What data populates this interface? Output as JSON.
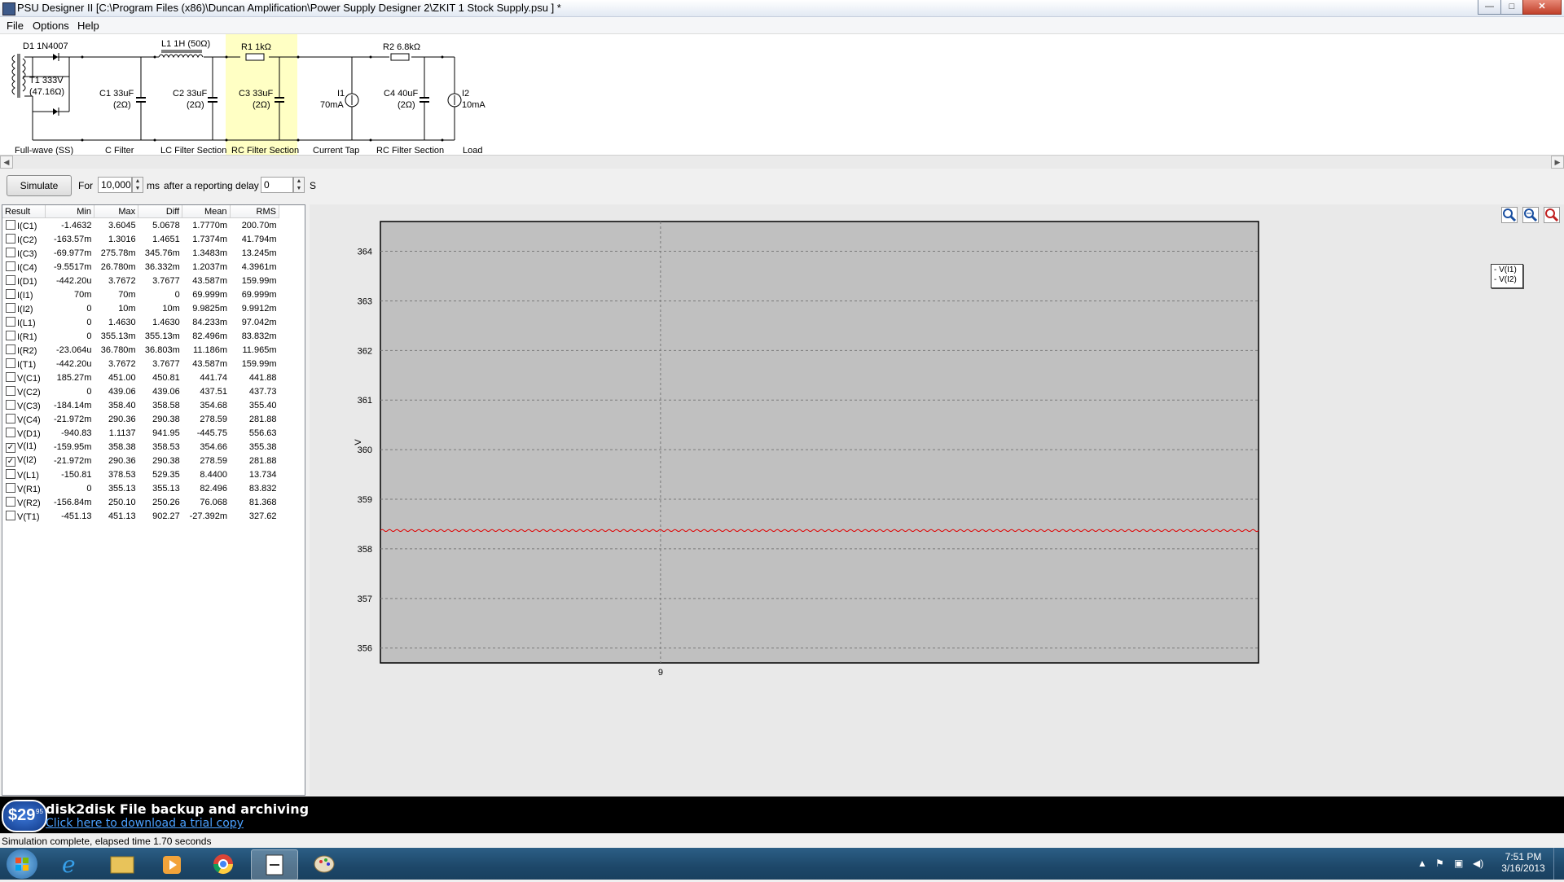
{
  "window": {
    "title": "PSU Designer II  [C:\\Program Files (x86)\\Duncan Amplification\\Power Supply Designer 2\\ZKIT 1 Stock Supply.psu ] *",
    "minimize": "—",
    "maximize": "□",
    "close": "✕"
  },
  "menu": [
    "File",
    "Options",
    "Help"
  ],
  "schematic": {
    "components": {
      "d1": "D1 1N4007",
      "t1": "T1 333V",
      "t1_res": "(47.16Ω)",
      "c1": "C1 33uF",
      "c1_res": "(2Ω)",
      "l1": "L1 1H (50Ω)",
      "c2": "C2 33uF",
      "c2_res": "(2Ω)",
      "r1": "R1 1kΩ",
      "c3": "C3 33uF",
      "c3_res": "(2Ω)",
      "i1": "I1",
      "i1_val": "70mA",
      "r2": "R2 6.8kΩ",
      "c4": "C4 40uF",
      "c4_res": "(2Ω)",
      "i2": "I2",
      "i2_val": "10mA"
    },
    "sections": [
      "Full-wave (SS)",
      "C Filter",
      "LC Filter Section",
      "RC Filter Section",
      "Current Tap",
      "RC Filter Section",
      "Load"
    ]
  },
  "controls": {
    "simulate_label": "Simulate",
    "for_label": "For",
    "duration_value": "10,000",
    "ms_label": "ms",
    "delay_label": "after a reporting delay of",
    "delay_value": "0",
    "s_label": "S"
  },
  "results": {
    "columns": [
      "Result",
      "Min",
      "Max",
      "Diff",
      "Mean",
      "RMS"
    ],
    "rows": [
      {
        "name": "I(C1)",
        "checked": false,
        "min": "-1.4632",
        "max": "3.6045",
        "diff": "5.0678",
        "mean": "1.7770m",
        "rms": "200.70m"
      },
      {
        "name": "I(C2)",
        "checked": false,
        "min": "-163.57m",
        "max": "1.3016",
        "diff": "1.4651",
        "mean": "1.7374m",
        "rms": "41.794m"
      },
      {
        "name": "I(C3)",
        "checked": false,
        "min": "-69.977m",
        "max": "275.78m",
        "diff": "345.76m",
        "mean": "1.3483m",
        "rms": "13.245m"
      },
      {
        "name": "I(C4)",
        "checked": false,
        "min": "-9.5517m",
        "max": "26.780m",
        "diff": "36.332m",
        "mean": "1.2037m",
        "rms": "4.3961m"
      },
      {
        "name": "I(D1)",
        "checked": false,
        "min": "-442.20u",
        "max": "3.7672",
        "diff": "3.7677",
        "mean": "43.587m",
        "rms": "159.99m"
      },
      {
        "name": "I(I1)",
        "checked": false,
        "min": "70m",
        "max": "70m",
        "diff": "0",
        "mean": "69.999m",
        "rms": "69.999m"
      },
      {
        "name": "I(I2)",
        "checked": false,
        "min": "0",
        "max": "10m",
        "diff": "10m",
        "mean": "9.9825m",
        "rms": "9.9912m"
      },
      {
        "name": "I(L1)",
        "checked": false,
        "min": "0",
        "max": "1.4630",
        "diff": "1.4630",
        "mean": "84.233m",
        "rms": "97.042m"
      },
      {
        "name": "I(R1)",
        "checked": false,
        "min": "0",
        "max": "355.13m",
        "diff": "355.13m",
        "mean": "82.496m",
        "rms": "83.832m"
      },
      {
        "name": "I(R2)",
        "checked": false,
        "min": "-23.064u",
        "max": "36.780m",
        "diff": "36.803m",
        "mean": "11.186m",
        "rms": "11.965m"
      },
      {
        "name": "I(T1)",
        "checked": false,
        "min": "-442.20u",
        "max": "3.7672",
        "diff": "3.7677",
        "mean": "43.587m",
        "rms": "159.99m"
      },
      {
        "name": "V(C1)",
        "checked": false,
        "min": "185.27m",
        "max": "451.00",
        "diff": "450.81",
        "mean": "441.74",
        "rms": "441.88"
      },
      {
        "name": "V(C2)",
        "checked": false,
        "min": "0",
        "max": "439.06",
        "diff": "439.06",
        "mean": "437.51",
        "rms": "437.73"
      },
      {
        "name": "V(C3)",
        "checked": false,
        "min": "-184.14m",
        "max": "358.40",
        "diff": "358.58",
        "mean": "354.68",
        "rms": "355.40"
      },
      {
        "name": "V(C4)",
        "checked": false,
        "min": "-21.972m",
        "max": "290.36",
        "diff": "290.38",
        "mean": "278.59",
        "rms": "281.88"
      },
      {
        "name": "V(D1)",
        "checked": false,
        "min": "-940.83",
        "max": "1.1137",
        "diff": "941.95",
        "mean": "-445.75",
        "rms": "556.63"
      },
      {
        "name": "V(I1)",
        "checked": true,
        "min": "-159.95m",
        "max": "358.38",
        "diff": "358.53",
        "mean": "354.66",
        "rms": "355.38"
      },
      {
        "name": "V(I2)",
        "checked": true,
        "min": "-21.972m",
        "max": "290.36",
        "diff": "290.38",
        "mean": "278.59",
        "rms": "281.88"
      },
      {
        "name": "V(L1)",
        "checked": false,
        "min": "-150.81",
        "max": "378.53",
        "diff": "529.35",
        "mean": "8.4400",
        "rms": "13.734"
      },
      {
        "name": "V(R1)",
        "checked": false,
        "min": "0",
        "max": "355.13",
        "diff": "355.13",
        "mean": "82.496",
        "rms": "83.832"
      },
      {
        "name": "V(R2)",
        "checked": false,
        "min": "-156.84m",
        "max": "250.10",
        "diff": "250.26",
        "mean": "76.068",
        "rms": "81.368"
      },
      {
        "name": "V(T1)",
        "checked": false,
        "min": "-451.13",
        "max": "451.13",
        "diff": "902.27",
        "mean": "-27.392m",
        "rms": "327.62"
      }
    ]
  },
  "chart_data": {
    "type": "line",
    "title": "",
    "xlabel": "",
    "ylabel": "V",
    "y_ticks": [
      356,
      357,
      358,
      359,
      360,
      361,
      362,
      363,
      364
    ],
    "ylim": [
      355.7,
      364.6
    ],
    "x_ticks": [
      "9"
    ],
    "grid": true,
    "legend": {
      "placement": "right",
      "entries": [
        "V(I1)",
        "V(I2)"
      ]
    },
    "series": [
      {
        "name": "V(I1)",
        "color": "#e00000",
        "mean": 358.37,
        "ripple": 0.02,
        "cycles": 120
      }
    ]
  },
  "banner": {
    "price": "$29",
    "price_cents": "95",
    "headline": "disk2disk File backup and archiving",
    "link": "Click here to download a trial copy"
  },
  "status": "Simulation complete, elapsed time 1.70 seconds",
  "taskbar": {
    "time": "7:51 PM",
    "date": "3/16/2013"
  }
}
